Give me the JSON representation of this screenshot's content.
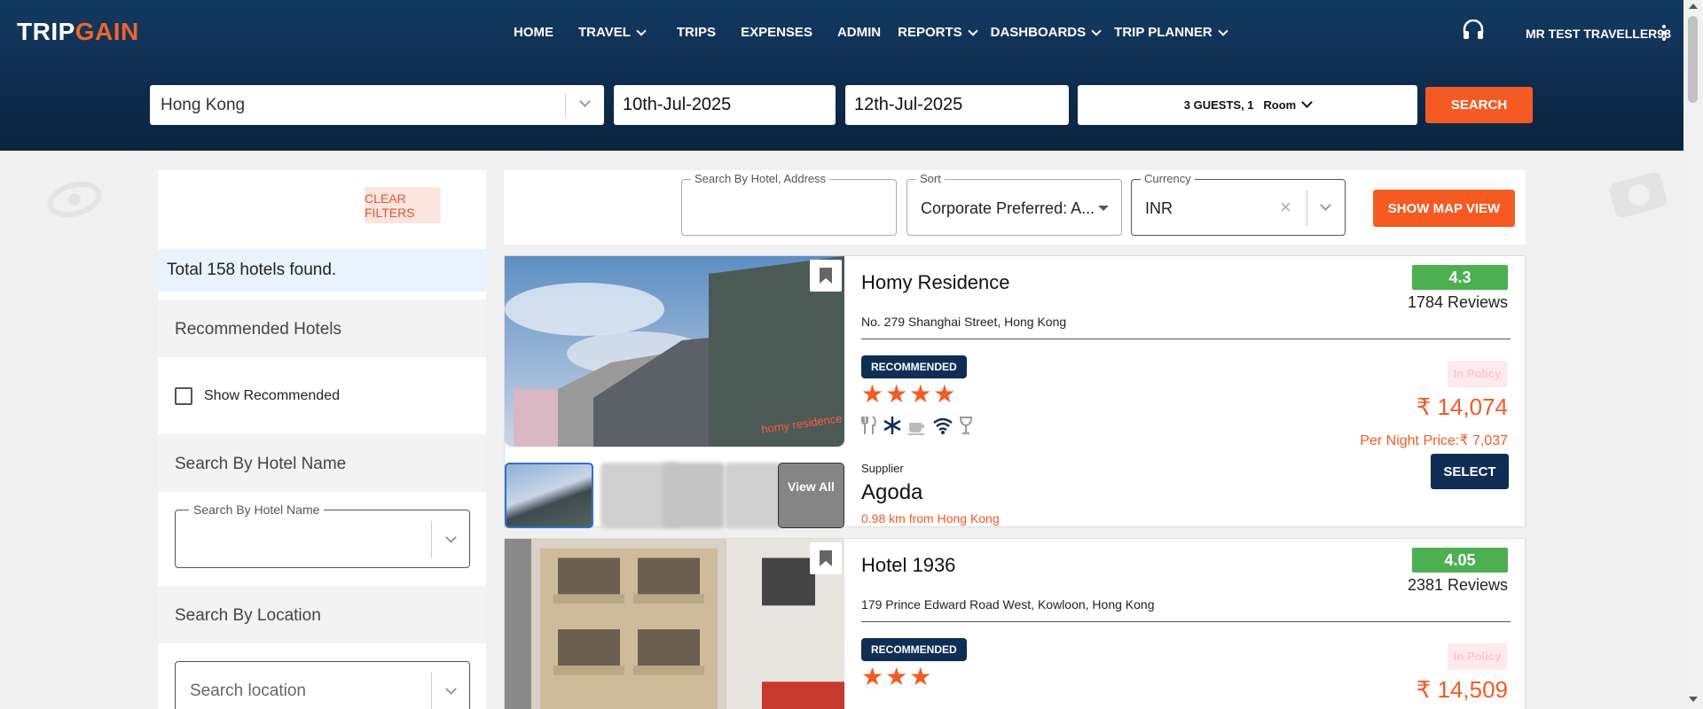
{
  "brand": {
    "logo_part1": "TRIP",
    "logo_part2": "GAIN",
    "accent": "#f55a23",
    "navy": "#0e2e55"
  },
  "nav": {
    "items": [
      {
        "label": "HOME",
        "dropdown": false
      },
      {
        "label": "TRAVEL",
        "dropdown": true
      },
      {
        "label": "TRIPS",
        "dropdown": false
      },
      {
        "label": "EXPENSES",
        "dropdown": false
      },
      {
        "label": "ADMIN",
        "dropdown": false
      },
      {
        "label": "REPORTS",
        "dropdown": true
      },
      {
        "label": "DASHBOARDS",
        "dropdown": true
      },
      {
        "label": "TRIP PLANNER",
        "dropdown": true
      }
    ],
    "user": "MR TEST TRAVELLER98",
    "support_icon": "headset-icon",
    "menu_icon": "kebab-menu-icon"
  },
  "search": {
    "destination": "Hong Kong",
    "checkin": "10th-Jul-2025",
    "checkout": "12th-Jul-2025",
    "guests": "3 GUESTS, 1",
    "rooms": "Room",
    "button": "SEARCH"
  },
  "sidebar": {
    "clear_filters": "CLEAR FILTERS",
    "total": "Total 158 hotels found.",
    "recommended_heading": "Recommended Hotels",
    "show_recommended": "Show Recommended",
    "hotel_name_heading": "Search By Hotel Name",
    "hotel_name_legend": "Search By Hotel Name",
    "location_heading": "Search By Location",
    "location_placeholder": "Search location"
  },
  "toolbar": {
    "search_label": "Search By Hotel, Address",
    "sort_label": "Sort",
    "sort_value": "Corporate Preferred: A...",
    "currency_label": "Currency",
    "currency_value": "INR",
    "map_button": "SHOW MAP VIEW"
  },
  "hotels": [
    {
      "name": "Homy Residence",
      "address": "No. 279 Shanghai Street, Hong Kong",
      "badge": "RECOMMENDED",
      "stars": "★★★★",
      "star_count": 4,
      "rating": "4.3",
      "reviews": "1784 Reviews",
      "policy": "In Policy",
      "price": "₹ 14,074",
      "per_night": "Per Night Price:₹ 7,037",
      "select": "SELECT",
      "supplier_label": "Supplier",
      "supplier": "Agoda",
      "distance": "0.98 km from Hong Kong",
      "view_all": "View All"
    },
    {
      "name": "Hotel 1936",
      "address": "179 Prince Edward Road West, Kowloon, Hong Kong",
      "badge": "RECOMMENDED",
      "stars": "★★★",
      "star_count": 3,
      "rating": "4.05",
      "reviews": "2381 Reviews",
      "policy": "In Policy",
      "price": "₹ 14,509"
    }
  ]
}
